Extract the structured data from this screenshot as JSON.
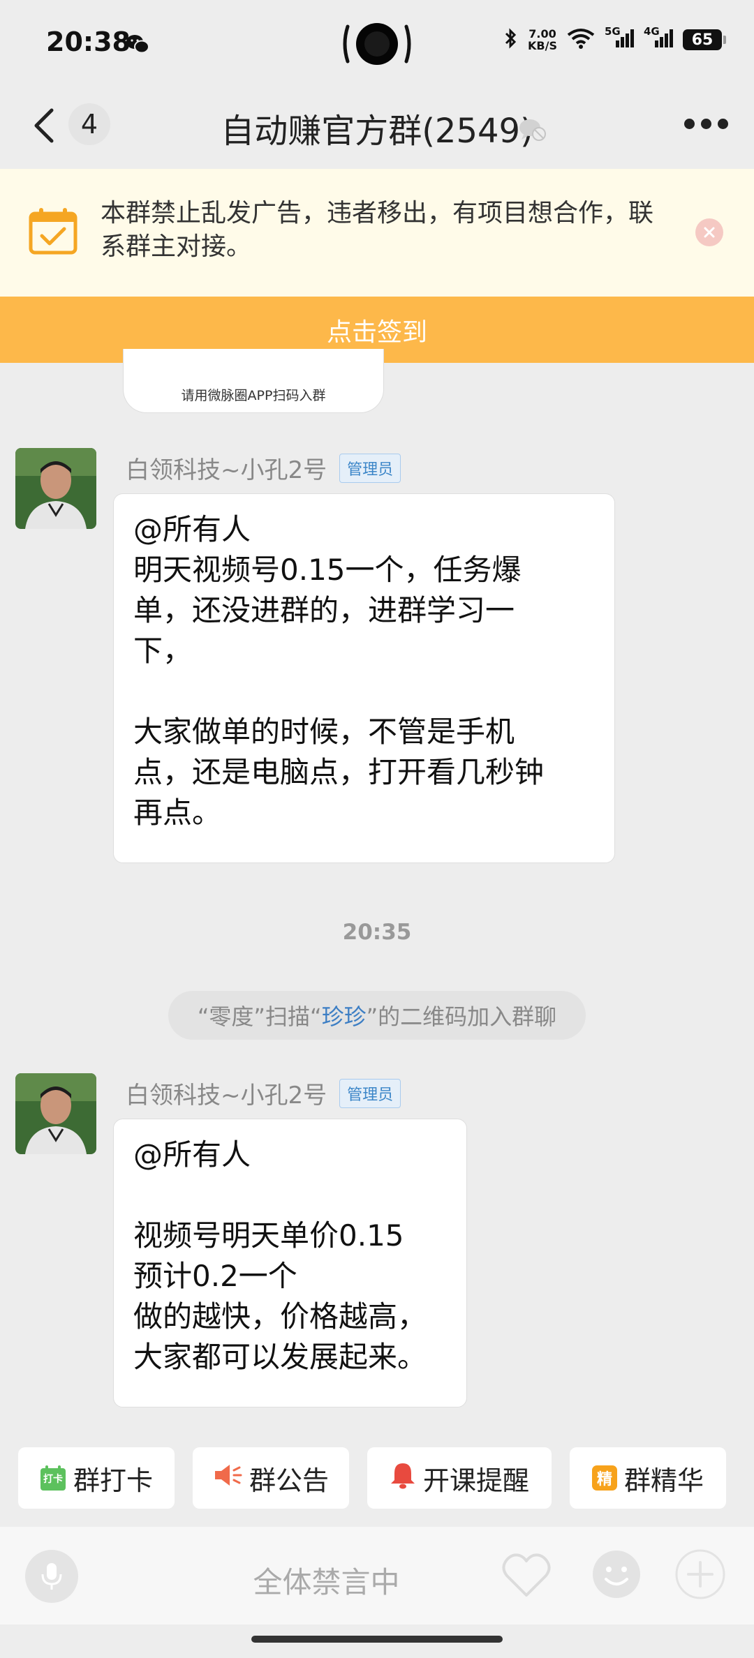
{
  "status_bar": {
    "time": "20:38",
    "net_speed": "7.00",
    "net_unit": "KB/S",
    "sig1": "5G",
    "sig2": "4G",
    "battery": "65"
  },
  "header": {
    "unread_count": "4",
    "title": "自动赚官方群(2549)"
  },
  "notice": {
    "text": "本群禁止乱发广告，违者移出，有项目想合作，联系群主对接。",
    "checkin_label": "点击签到"
  },
  "qr_card": {
    "caption": "请用微脉圈APP扫码入群"
  },
  "messages": [
    {
      "sender": "白领科技~小孔2号",
      "role": "管理员",
      "lines": [
        "@所有人",
        "明天视频号0.15一个，任务爆",
        "单，还没进群的，进群学习一",
        "下，",
        "",
        "大家做单的时候，不管是手机",
        "点，还是电脑点，打开看几秒钟",
        "再点。"
      ]
    },
    {
      "sender": "白领科技~小孔2号",
      "role": "管理员",
      "lines": [
        "@所有人",
        "",
        "视频号明天单价0.15",
        "预计0.2一个",
        "做的越快，价格越高，",
        "大家都可以发展起来。"
      ]
    }
  ],
  "timestamp": "20:35",
  "system_message": {
    "prefix": "“零度”扫描“",
    "link": "珍珍",
    "suffix": "”的二维码加入群聊"
  },
  "quick_actions": [
    {
      "label": "群打卡",
      "icon_text": "打卡"
    },
    {
      "label": "群公告"
    },
    {
      "label": "开课提醒"
    },
    {
      "label": "群精华",
      "icon_text": "精"
    }
  ],
  "input_bar": {
    "status": "全体禁言中"
  },
  "colors": {
    "accent_orange": "#fdb84a",
    "notice_bg": "#fffbe9",
    "link_blue": "#3c7ec4",
    "bg": "#ededed"
  }
}
